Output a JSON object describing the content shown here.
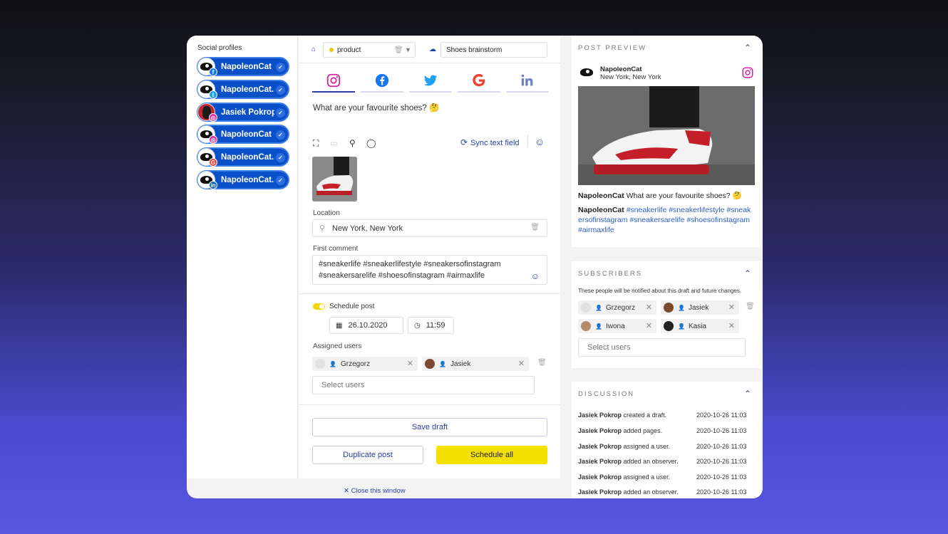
{
  "left": {
    "title": "Social profiles",
    "profiles": [
      {
        "name": "NapoleonCat",
        "network": "facebook"
      },
      {
        "name": "NapoleonCat....",
        "network": "twitter"
      },
      {
        "name": "Jasiek Pokrop",
        "network": "instagram"
      },
      {
        "name": "NapoleonCat",
        "network": "instagram"
      },
      {
        "name": "NapoleonCat....",
        "network": "google"
      },
      {
        "name": "NapoleonCat....",
        "network": "linkedin"
      }
    ]
  },
  "editor": {
    "tag": "product",
    "draft_name": "Shoes brainstorm",
    "tabs": [
      "instagram",
      "facebook",
      "twitter",
      "google",
      "linkedin"
    ],
    "post_text": "What are your favourite shoes? 🤔",
    "sync_label": "Sync text field",
    "location_label": "Location",
    "location_value": "New York, New York",
    "first_comment_label": "First comment",
    "first_comment_line1": "#sneakerlife #sneakerlifestyle #sneakersofinstagram",
    "first_comment_line2": "#sneakersarelife #shoesofinstagram #airmaxlife",
    "schedule_label": "Schedule post",
    "date": "26.10.2020",
    "time": "11:59",
    "assigned_label": "Assigned users",
    "assigned": [
      "Grzegorz",
      "Jasiek"
    ],
    "select_users_placeholder": "Select users",
    "save_draft": "Save draft",
    "duplicate": "Duplicate post",
    "schedule_all": "Schedule all",
    "close": "✕ Close this window"
  },
  "preview": {
    "title": "POST PREVIEW",
    "account": "NapoleonCat",
    "location": "New York, New York",
    "caption_user": "NapoleonCat",
    "caption": " What are your favourite shoes? 🤔",
    "comment_user": "NapoleonCat",
    "comment_hashtags": "#sneakerlife #sneakerlifestyle #sneakersofinstagram #sneakersarelife #shoesofinstagram #airmaxlife"
  },
  "subscribers": {
    "title": "SUBSCRIBERS",
    "note": "These people will be notified about this draft and future changes.",
    "people": [
      "Grzegorz",
      "Jasiek",
      "Iwona",
      "Kasia"
    ],
    "select_users_placeholder": "Select users"
  },
  "discussion": {
    "title": "DISCUSSION",
    "entries": [
      {
        "user": "Jasiek Pokrop",
        "action": "created a draft.",
        "time": "2020-10-26 11:03"
      },
      {
        "user": "Jasiek Pokrop",
        "action": "added pages.",
        "time": "2020-10-26 11:03"
      },
      {
        "user": "Jasiek Pokrop",
        "action": "assigned a user.",
        "time": "2020-10-26 11:03"
      },
      {
        "user": "Jasiek Pokrop",
        "action": "added an observer.",
        "time": "2020-10-26 11:03"
      },
      {
        "user": "Jasiek Pokrop",
        "action": "assigned a user.",
        "time": "2020-10-26 11:03"
      },
      {
        "user": "Jasiek Pokrop",
        "action": "added an observer.",
        "time": "2020-10-26 11:03"
      }
    ]
  },
  "colors": {
    "accent": "#2c3ea6",
    "profile_blue": "#0b50c8",
    "yellow": "#f5e100"
  }
}
